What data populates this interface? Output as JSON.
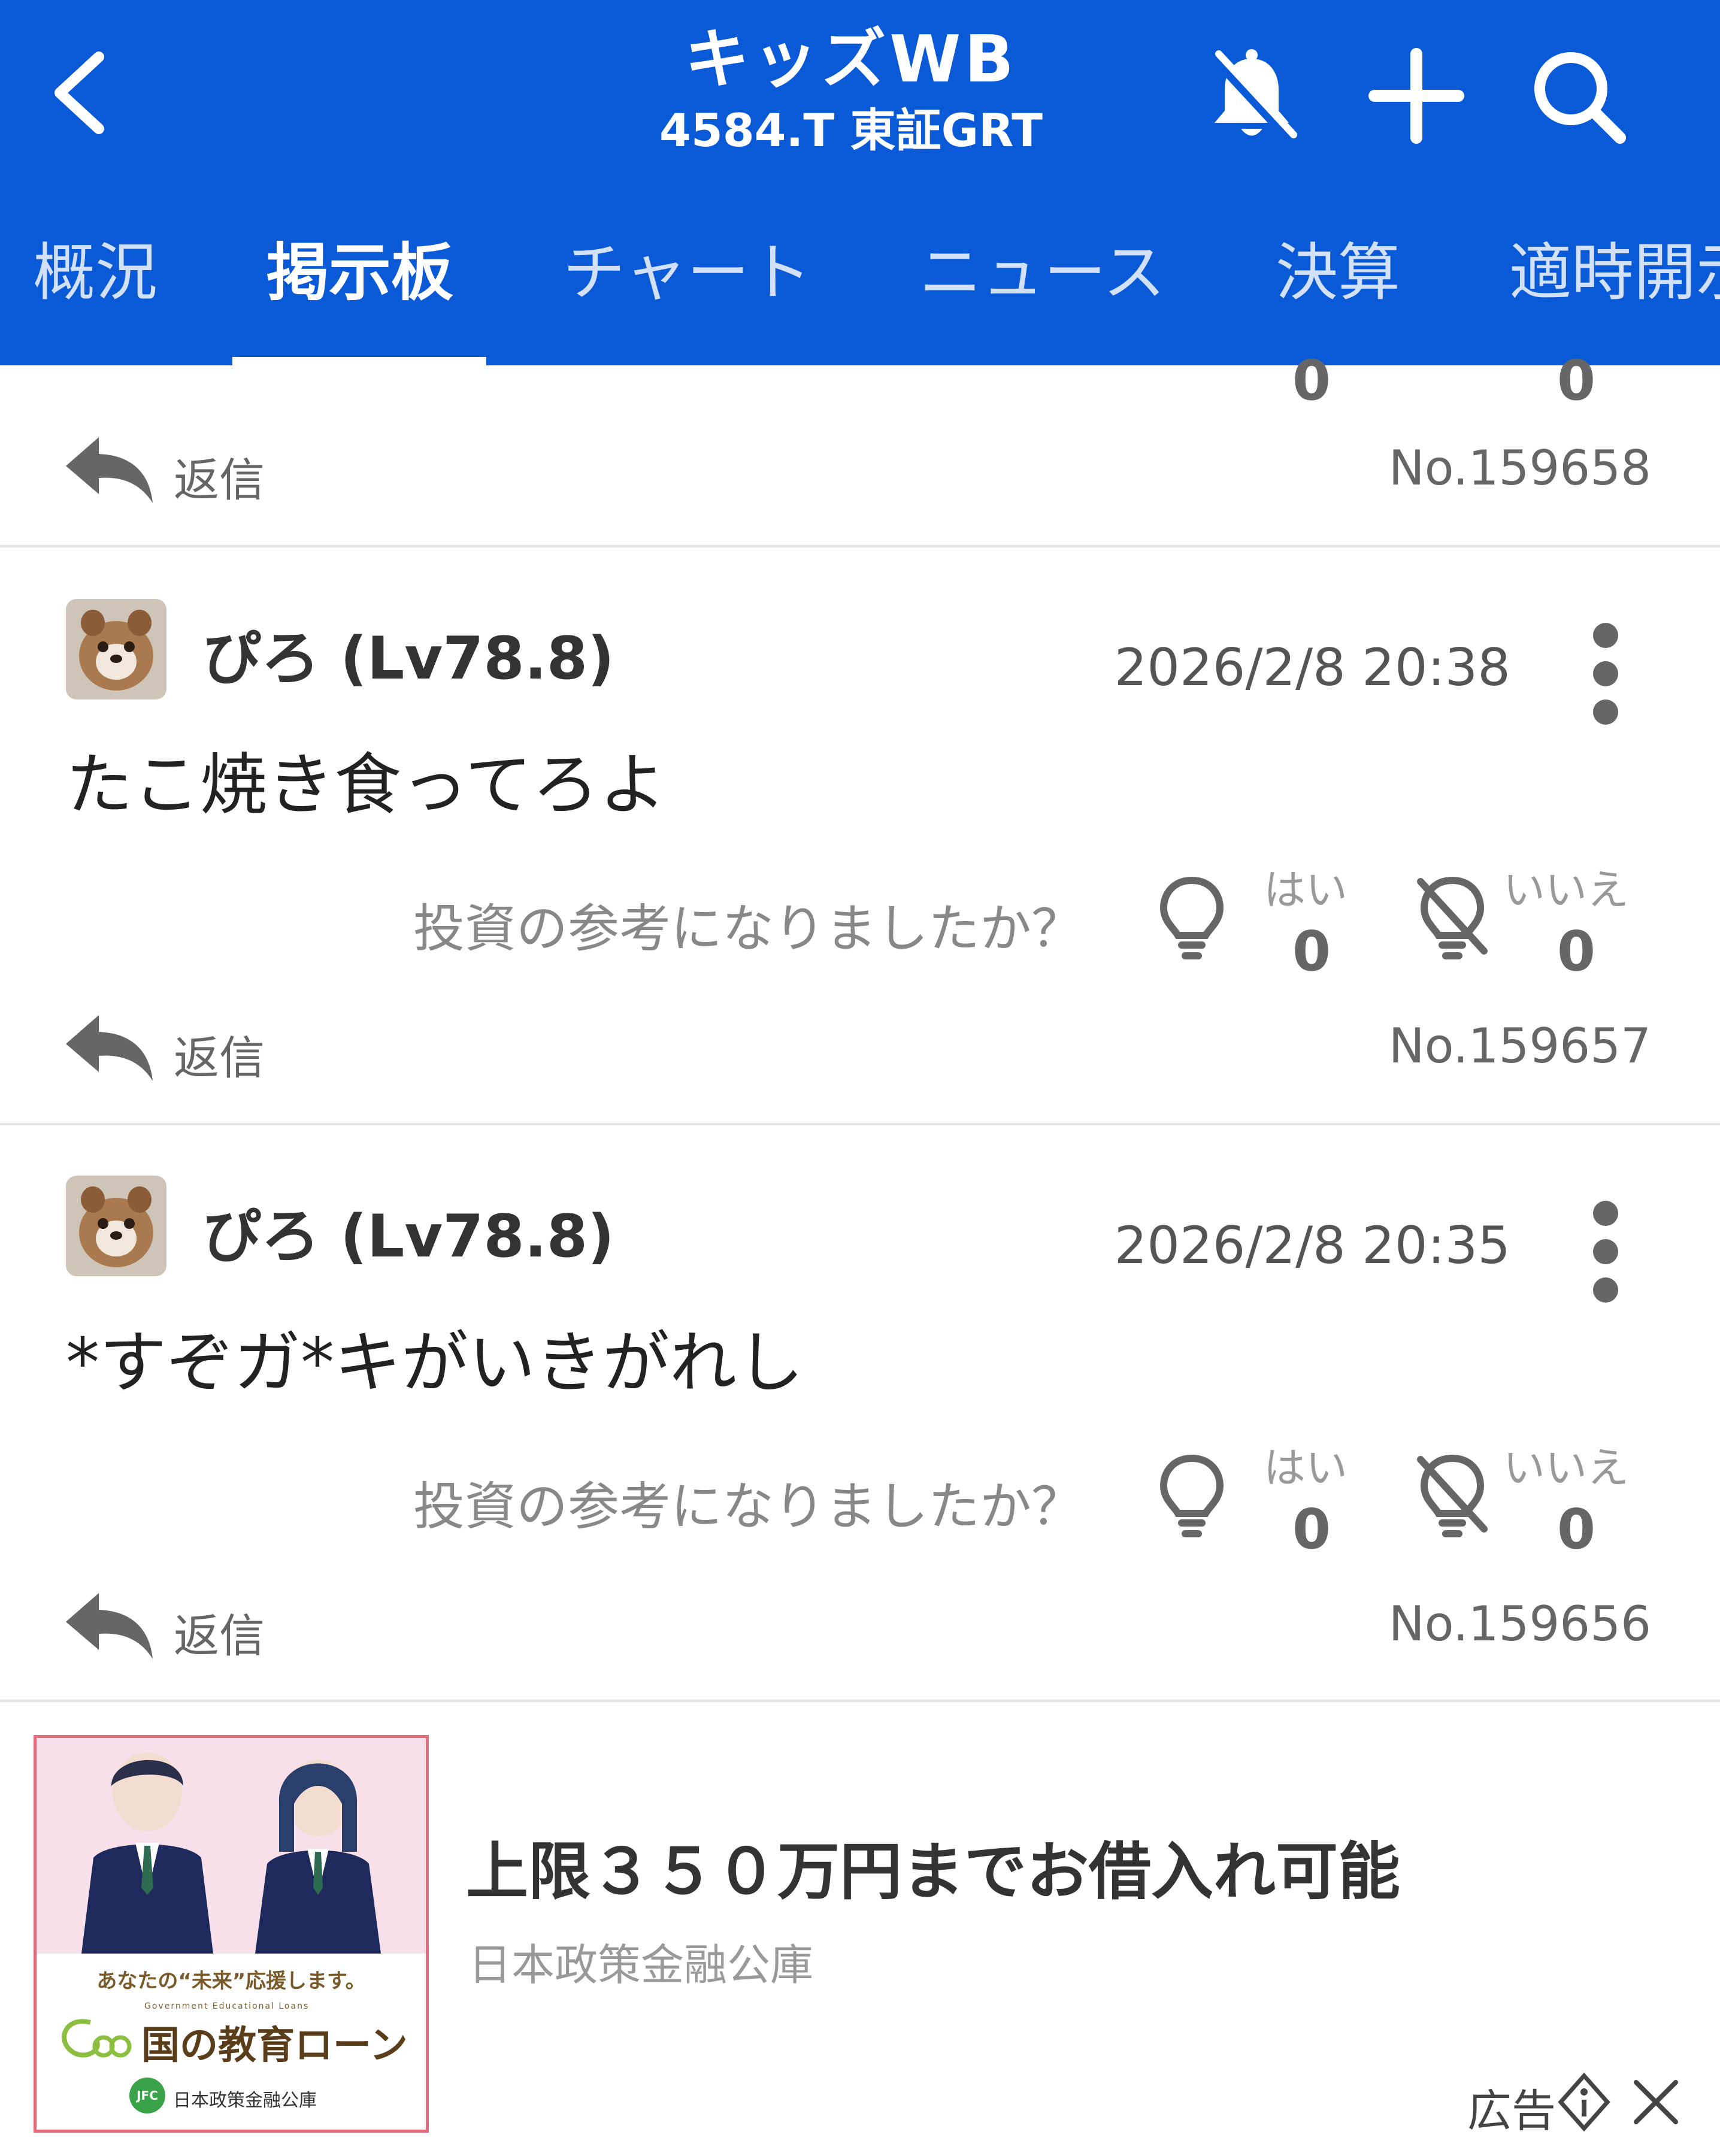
{
  "header": {
    "title": "キッズWB",
    "subtitle": "4584.T 東証GRT",
    "icons": [
      "back-chevron-icon",
      "bell-off-icon",
      "plus-icon",
      "search-icon"
    ]
  },
  "tabs": [
    {
      "label": "概況"
    },
    {
      "label": "掲示板",
      "active": true
    },
    {
      "label": "チャート"
    },
    {
      "label": "ニュース"
    },
    {
      "label": "決算"
    },
    {
      "label": "適時開示"
    }
  ],
  "top_partial_post": {
    "yes_count": "0",
    "no_count": "0",
    "reply_label": "返信",
    "post_no": "No.159658"
  },
  "posts": [
    {
      "username": "ぴろ (Lv78.8)",
      "timestamp": "2026/2/8 20:38",
      "text": "たこ焼き食ってろよ",
      "question": "投資の参考になりましたか？",
      "yes_label": "はい",
      "yes_count": "0",
      "no_label": "いいえ",
      "no_count": "0",
      "reply_label": "返信",
      "post_no": "No.159657"
    },
    {
      "username": "ぴろ (Lv78.8)",
      "timestamp": "2026/2/8 20:35",
      "text": "*すぞガ*キがいきがれし",
      "question": "投資の参考になりましたか？",
      "yes_label": "はい",
      "yes_count": "0",
      "no_label": "いいえ",
      "no_count": "0",
      "reply_label": "返信",
      "post_no": "No.159656"
    }
  ],
  "ad": {
    "title": "上限３５０万円までお借入れ可能",
    "sponsor": "日本政策金融公庫",
    "label": "広告",
    "image_caption": "あなたの“未来”応援します。",
    "image_brand_en": "Government Educational Loans",
    "image_brand": "国の教育ローン",
    "image_logo_text": "日本政策金融公庫",
    "image_logo_mark": "JFC"
  },
  "colors": {
    "header_bg": "#0a5ad7",
    "divider": "#e3e3e3",
    "ad_border": "#e36a78"
  }
}
